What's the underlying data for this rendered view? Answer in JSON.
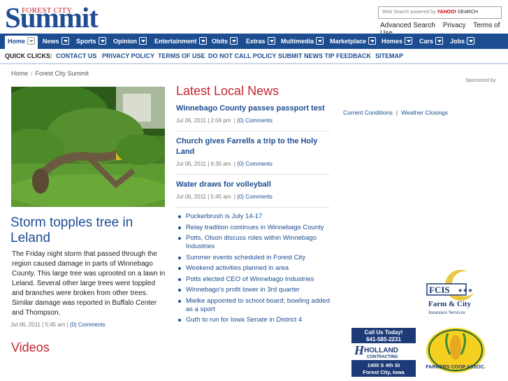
{
  "header": {
    "logo_small": "FOREST CITY",
    "logo_big": "Summit",
    "search": {
      "powered_text": "Web Search powered by",
      "yahoo_text": "YAHOO!",
      "search_text": "SEARCH"
    },
    "util_links": [
      "Advanced Search",
      "Privacy",
      "Terms of Use"
    ]
  },
  "nav": {
    "items": [
      {
        "label": "Home"
      },
      {
        "label": "News"
      },
      {
        "label": "Sports"
      },
      {
        "label": "Opinion"
      },
      {
        "label": "Entertainment"
      },
      {
        "label": "Obits"
      },
      {
        "label": "Extras"
      },
      {
        "label": "Multimedia"
      },
      {
        "label": "Marketplace"
      },
      {
        "label": "Homes"
      },
      {
        "label": "Cars"
      },
      {
        "label": "Jobs"
      }
    ]
  },
  "quick_clicks": {
    "label": "QUICK CLICKS:",
    "links": [
      "CONTACT US",
      "PRIVACY POLICY",
      "TERMS OF USE",
      "DO NOT CALL POLICY",
      "SUBMIT NEWS TIP",
      "FEEDBACK",
      "SITEMAP"
    ]
  },
  "breadcrumb": {
    "home": "Home",
    "sep": "/",
    "current": "Forest City Summit"
  },
  "sponsored_by": "Sponsored by:",
  "feature": {
    "title": "Storm topples tree in Leland",
    "text": "The Friday night storm that passed through the region caused damage in parts of Winnebago County. This large tree was uprooted on a lawn in Leland. Several other large trees were toppled and branches were broken from other trees. Similar damage was reported in Buffalo Center and Thompson.",
    "date": "Jul 06, 2011 | 5:45 am",
    "comments": "(0) Comments"
  },
  "videos_title": "Videos",
  "latest": {
    "title": "Latest Local News",
    "stories": [
      {
        "title": "Winnebago County passes passport test",
        "date": "Jul 06, 2011 | 2:04 pm",
        "comments": "(0) Comments"
      },
      {
        "title": "Church gives Farrells a trip to the Holy Land",
        "date": "Jul 06, 2011 | 6:30 am",
        "comments": "(0) Comments"
      },
      {
        "title": "Water draws for volleyball",
        "date": "Jul 06, 2011 | 5:45 am",
        "comments": "(0) Comments"
      }
    ],
    "headlines": [
      "Puckerbrush is July 14-17",
      "Relay tradition continues in Winnebago County",
      "Potts, Olson discuss roles within Winnebago Industries",
      "Summer events scheduled in Forest City",
      "Weekend activities planned in area",
      "Potts elected CEO of Winnebago Industries",
      "Winnebago's profit lower in 3rd quarter",
      "Mielke appointed to school board; bowling added as a sport",
      "Guth to run for Iowa Senate in District 4"
    ]
  },
  "right_links": {
    "current_conditions": "Current Conditions",
    "sep": "|",
    "weather_closings": "Weather Closings"
  },
  "ads": {
    "fcis": {
      "badge": "FCIS",
      "stars": "★★★",
      "line1": "Farm & City",
      "line2": "Insurance Services"
    },
    "holland": {
      "top": "Call Us Today!",
      "phone": "641-585-2231",
      "brand": "HOLLAND",
      "sub": "CONTRACTING",
      "addr1": "1400 S 4th St",
      "addr2": "Forest City, Iowa"
    },
    "farmers": {
      "name": "FARMERS COOP ASSOC."
    }
  },
  "colors": {
    "brand_blue": "#1d4d91",
    "accent_red": "#c4262e"
  }
}
